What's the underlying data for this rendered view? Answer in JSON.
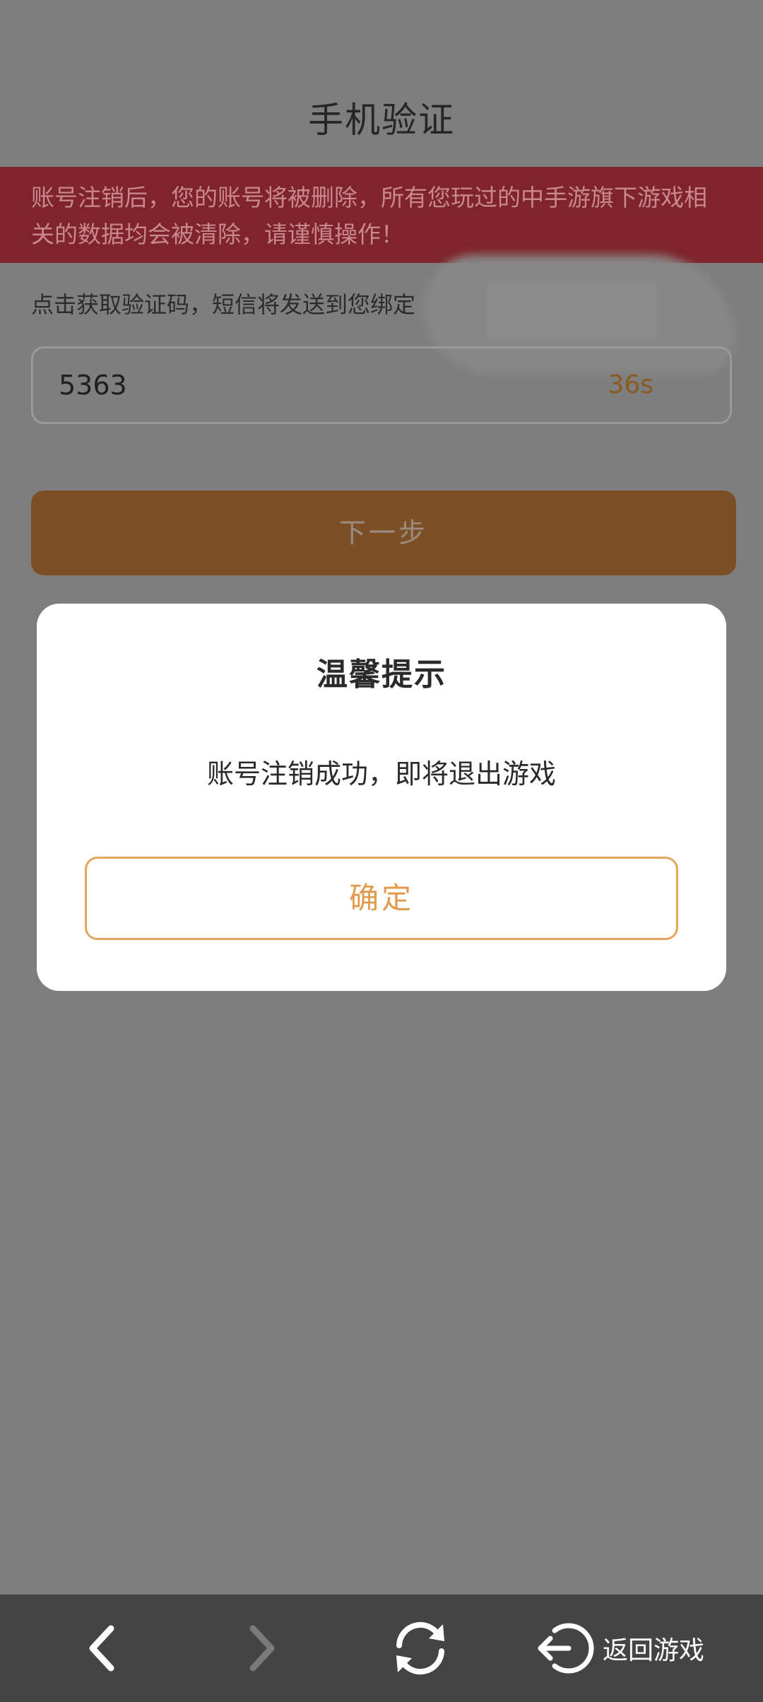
{
  "page": {
    "title": "手机验证",
    "warning_line1": "账号注销后，您的账号将被删除，所有您玩过的中手游旗下游戏相",
    "warning_line2": "关的数据均会被清除，请谨慎操作！",
    "hint": "点击获取验证码，短信将发送到您绑定",
    "code_value": "5363",
    "countdown": "36s",
    "next_label": "下一步"
  },
  "dialog": {
    "title": "温馨提示",
    "message": "账号注销成功，即将退出游戏",
    "confirm_label": "确定"
  },
  "bottom_bar": {
    "back_icon": "chevron-left-icon",
    "forward_icon": "chevron-right-icon",
    "refresh_icon": "refresh-icon",
    "return_icon": "return-icon",
    "return_label": "返回游戏"
  },
  "colors": {
    "overlay": "#7d7e7d",
    "warning_bg": "#7f242a",
    "next_button": "#7c4f27",
    "accent": "#e29a4f",
    "bottom_bar": "#444444"
  }
}
